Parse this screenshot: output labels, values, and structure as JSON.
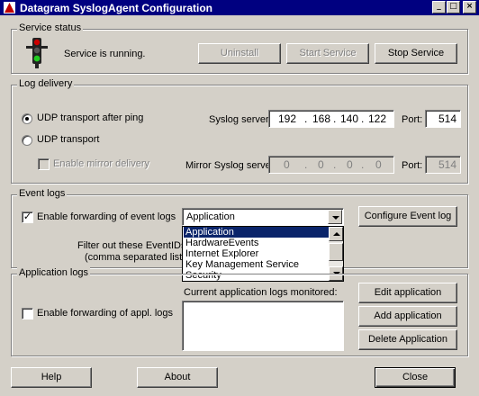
{
  "window": {
    "title": "Datagram SyslogAgent Configuration",
    "min_glyph": "_",
    "max_glyph": "□",
    "close_glyph": "×"
  },
  "service": {
    "group_label": "Service status",
    "status_text": "Service is running.",
    "uninstall_label": "Uninstall",
    "start_label": "Start Service",
    "stop_label": "Stop Service"
  },
  "log_delivery": {
    "group_label": "Log delivery",
    "radio_ping_label": "UDP transport after ping",
    "radio_udp_label": "UDP transport",
    "mirror_label": "Enable mirror delivery",
    "syslog_server_label": "Syslog server:",
    "syslog_ip": [
      "192",
      "168",
      "140",
      "122"
    ],
    "port_label": "Port:",
    "port_value": "514",
    "mirror_server_label": "Mirror Syslog server:",
    "mirror_ip": [
      "0",
      "0",
      "0",
      "0"
    ],
    "mirror_port_label": "Port:",
    "mirror_port_value": "514",
    "ip_dot": "."
  },
  "event_logs": {
    "group_label": "Event logs",
    "enable_label": "Enable forwarding of event logs",
    "check_glyph": "✓",
    "selected_log": "Application",
    "configure_label": "Configure Event log",
    "filter_label_line1": "Filter out these EventIDs:",
    "filter_label_line2": "(comma separated list)",
    "dropdown_options": [
      "Application",
      "HardwareEvents",
      "Internet Explorer",
      "Key Management Service",
      "Security"
    ]
  },
  "app_logs": {
    "group_label": "Application logs",
    "enable_label": "Enable forwarding of appl. logs",
    "monitored_label": "Current application logs monitored:",
    "edit_label": "Edit application",
    "add_label": "Add application",
    "delete_label": "Delete Application"
  },
  "footer": {
    "help_label": "Help",
    "about_label": "About",
    "close_label": "Close"
  },
  "colors": {
    "title_bar": "#000080",
    "selection": "#0a246a",
    "face": "#d4d0c8",
    "light_red": "#cc0000",
    "light_green": "#22cc22"
  }
}
